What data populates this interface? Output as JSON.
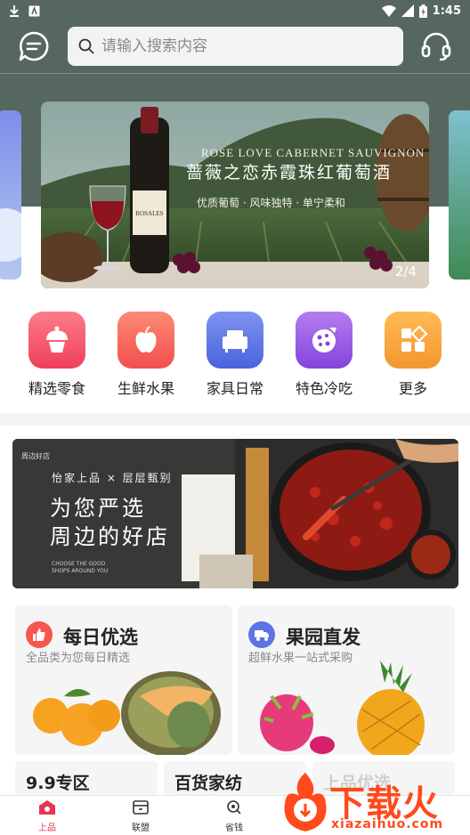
{
  "status_bar": {
    "time": "1:45"
  },
  "header": {
    "search_placeholder": "请输入搜索内容"
  },
  "banner": {
    "title_en": "ROSE LOVE CABERNET SAUVIGNON",
    "title_cn": "蔷薇之恋赤霞珠红葡萄酒",
    "tagline": "优质葡萄 · 风味独特 · 单宁柔和",
    "bottle_label": "ROSALES",
    "counter": "2/4"
  },
  "categories": [
    {
      "label": "精选零食",
      "icon": "cupcake-icon",
      "color": "#f5556b"
    },
    {
      "label": "生鲜水果",
      "icon": "apple-icon",
      "color": "#f7645a"
    },
    {
      "label": "家具日常",
      "icon": "sofa-icon",
      "color": "#5b74e6"
    },
    {
      "label": "特色冷吃",
      "icon": "pizza-icon",
      "color": "#9a57e3"
    },
    {
      "label": "更多",
      "icon": "grid-icon",
      "color": "#f5a23c"
    }
  ],
  "promo": {
    "tag": "周边好店",
    "line1": "怡家上品 × 层层甄别",
    "line2": "为您严选",
    "line3": "周边的好店",
    "en_line1": "CHOOSE THE GOOD",
    "en_line2": "SHOPS AROUND YOU"
  },
  "cards": [
    {
      "title": "每日优选",
      "subtitle": "全品类为您每日精选",
      "badge_icon": "thumbs-up-icon",
      "badge_color": "#f6564d"
    },
    {
      "title": "果园直发",
      "subtitle": "超鲜水果一站式采购",
      "badge_icon": "truck-icon",
      "badge_color": "#5b74e6"
    }
  ],
  "mini_cards": [
    {
      "title": "9.9专区"
    },
    {
      "title": "百货家纺"
    },
    {
      "title": "上品优选"
    }
  ],
  "tabbar": [
    {
      "label": "上品",
      "icon": "home-icon",
      "active": true
    },
    {
      "label": "联盟",
      "icon": "box-icon",
      "active": false
    },
    {
      "label": "省钱",
      "icon": "search-icon",
      "active": false
    }
  ],
  "watermark": {
    "text": "下载火",
    "url": "xiazaihuo.com"
  },
  "colors": {
    "header_bg": "#56675f",
    "accent": "#e83550"
  }
}
